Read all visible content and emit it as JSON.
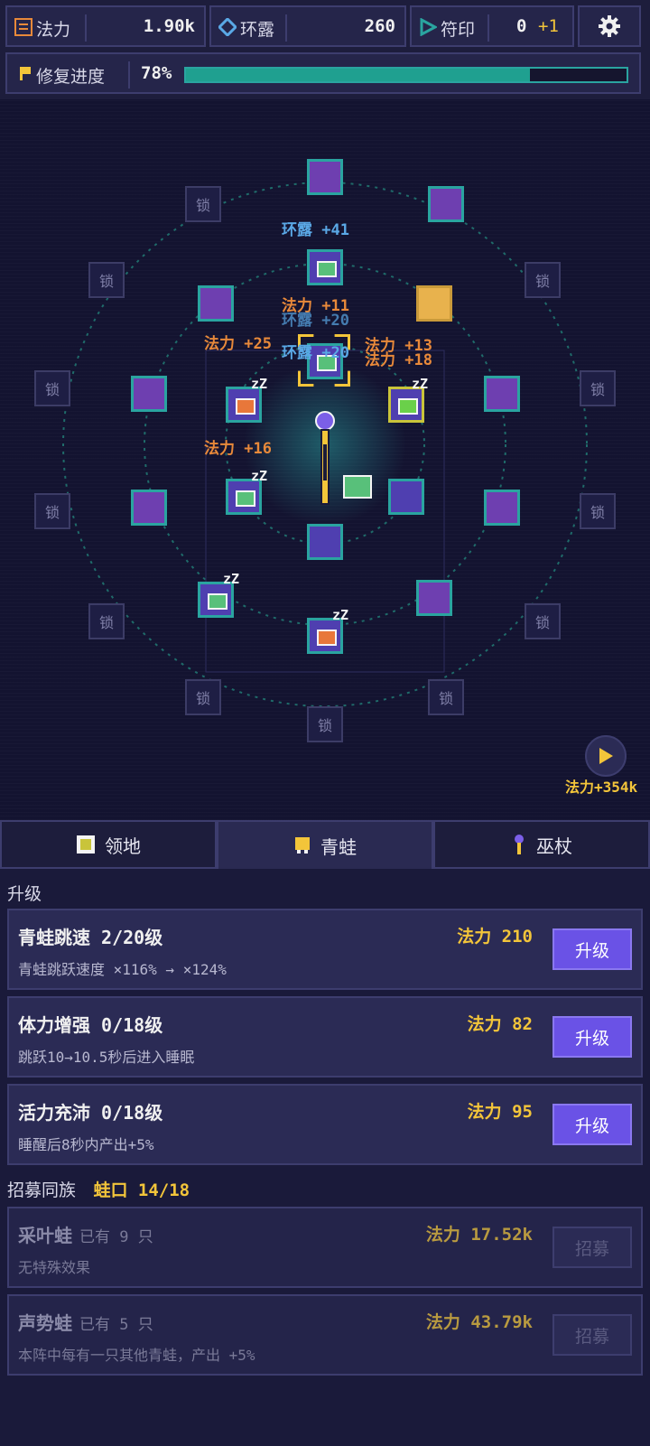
{
  "resources": {
    "mana": {
      "label": "法力",
      "value": "1.90k"
    },
    "dew": {
      "label": "环露",
      "value": "260"
    },
    "seal": {
      "label": "符印",
      "value": "0",
      "bonus": "+1"
    }
  },
  "progress": {
    "label": "修复进度",
    "percent_text": "78%",
    "percent": 0.78
  },
  "lock_label": "锁",
  "floats": [
    {
      "text": "环露 +41"
    },
    {
      "text": "法力 +11"
    },
    {
      "text": "环露 +20"
    },
    {
      "text": "法力 +25"
    },
    {
      "text": "环露 +20"
    },
    {
      "text": "法力 +13"
    },
    {
      "text": "法力 +18"
    },
    {
      "text": "法力 +16"
    }
  ],
  "play_reward": "法力+354k",
  "tabs": [
    {
      "label": "领地"
    },
    {
      "label": "青蛙"
    },
    {
      "label": "巫杖"
    }
  ],
  "upgrade_section": {
    "title": "升级"
  },
  "upgrades": [
    {
      "name": "青蛙跳速  2/20级",
      "desc": "青蛙跳跃速度 ×116% → ×124%",
      "cost": "法力 210",
      "button": "升级"
    },
    {
      "name": "体力增强  0/18级",
      "desc": "跳跃10→10.5秒后进入睡眠",
      "cost": "法力 82",
      "button": "升级"
    },
    {
      "name": "活力充沛  0/18级",
      "desc": "睡醒后8秒内产出+5%",
      "cost": "法力 95",
      "button": "升级"
    }
  ],
  "recruit_section": {
    "title": "招募同族",
    "capacity": "蛙口 14/18"
  },
  "recruits": [
    {
      "name": "采叶蛙",
      "owned": "已有 9 只",
      "desc": "无特殊效果",
      "cost": "法力 17.52k",
      "button": "招募"
    },
    {
      "name": "声势蛙",
      "owned": "已有 5 只",
      "desc": "本阵中每有一只其他青蛙，产出 +5%",
      "cost": "法力 43.79k",
      "button": "招募"
    }
  ],
  "colors": {
    "accent": "#6a52e6",
    "gold": "#f3c53a",
    "teal": "#2aa4a0",
    "dew": "#5aa8e6",
    "mana_float": "#e8893a"
  }
}
